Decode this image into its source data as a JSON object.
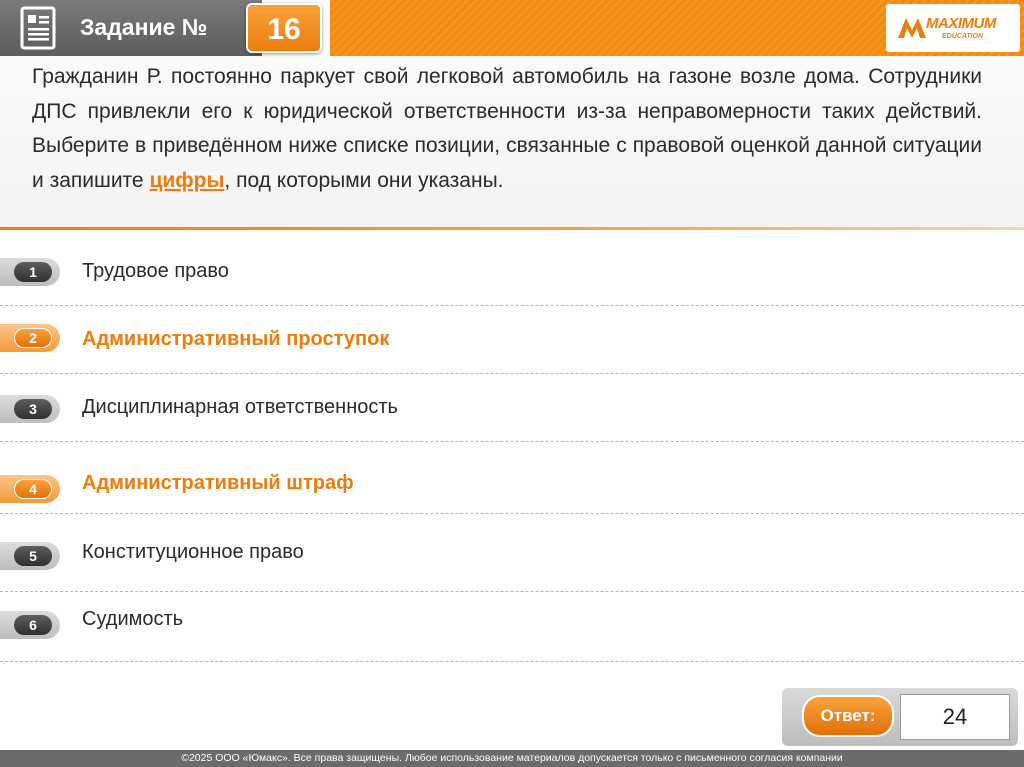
{
  "header": {
    "title": "Задание №",
    "task_number": "16",
    "logo_text": "MAXIMUM",
    "logo_sub": "EDUCATION",
    "accent_color": "#ec7d0d"
  },
  "question": {
    "text_before": "Гражданин Р. постоянно паркует свой легковой автомобиль на газоне возле дома. Сотрудники ДПС привлекли его к юридической ответственности из-за неправомерности таких действий. Выберите в приведённом ниже списке позиции, связанные с правовой оценкой данной ситуации и запишите ",
    "highlight": "цифры",
    "text_after": ", под которыми они указаны."
  },
  "options": [
    {
      "number": "1",
      "label": "Трудовое право",
      "selected": false
    },
    {
      "number": "2",
      "label": "Административный проступок",
      "selected": true
    },
    {
      "number": "3",
      "label": "Дисциплинарная ответственность",
      "selected": false
    },
    {
      "number": "4",
      "label": "Административный штраф",
      "selected": true
    },
    {
      "number": "5",
      "label": "Конституционное право",
      "selected": false
    },
    {
      "number": "6",
      "label": "Судимость",
      "selected": false
    }
  ],
  "answer": {
    "label": "Ответ:",
    "value": "24"
  },
  "footer": {
    "copyright": "©2025 ООО «Юмакс». Все права защищены. Любое использование материалов допускается только с  письменного согласия компании"
  }
}
